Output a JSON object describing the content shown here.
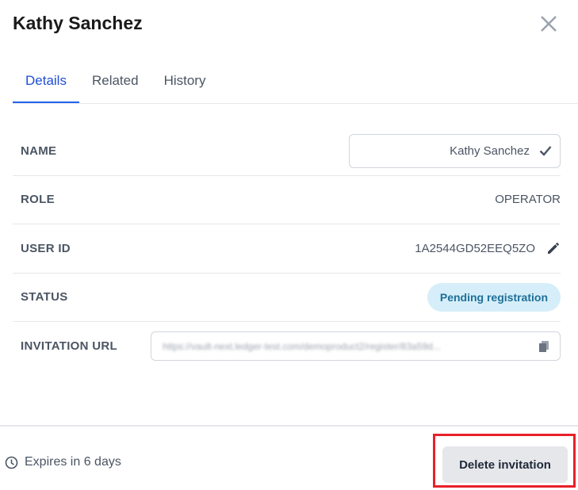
{
  "title": "Kathy Sanchez",
  "tabs": [
    {
      "label": "Details",
      "active": true
    },
    {
      "label": "Related"
    },
    {
      "label": "History"
    }
  ],
  "fields": {
    "name": {
      "label": "NAME",
      "value": "Kathy Sanchez"
    },
    "role": {
      "label": "ROLE",
      "value": "OPERATOR"
    },
    "user_id": {
      "label": "USER ID",
      "value": "1A2544GD52EEQ5ZO"
    },
    "status": {
      "label": "STATUS",
      "value": "Pending registration"
    },
    "invitation_url": {
      "label": "INVITATION URL",
      "value": "https://vault-next.ledger-test.com/demoproduct2/register/83a59d..."
    }
  },
  "footer": {
    "expires": "Expires in 6 days",
    "delete_label": "Delete invitation"
  },
  "colors": {
    "accent": "#2563eb",
    "badge_bg": "#d6eef9",
    "badge_text": "#1e6f98",
    "highlight": "#e8202a"
  }
}
